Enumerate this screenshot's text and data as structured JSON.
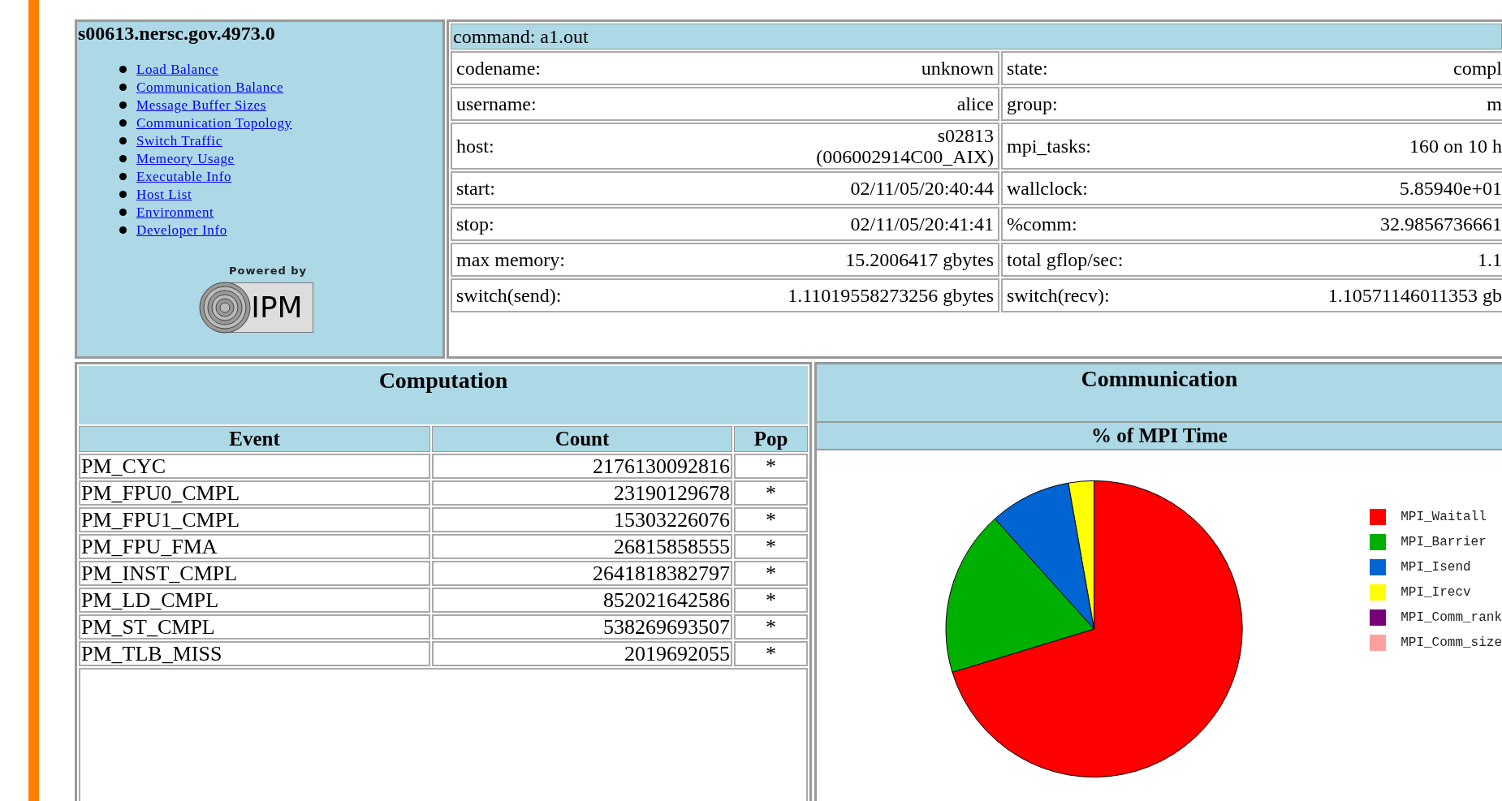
{
  "host_panel": {
    "title": "s00613.nersc.gov.4973.0",
    "links": [
      "Load Balance",
      "Communication Balance",
      "Message Buffer Sizes",
      "Communication Topology",
      "Switch Traffic",
      "Memeory Usage",
      "Executable Info",
      "Host List",
      "Environment",
      "Developer Info"
    ],
    "logo": {
      "caption": "Powered by",
      "name": "IPM"
    }
  },
  "summary": {
    "command": "command: a1.out",
    "rows": [
      {
        "label": "codename:",
        "value": [
          "unknown"
        ],
        "label_2": "state:",
        "value_2": "compl"
      },
      {
        "label": "username:",
        "value": [
          "alice"
        ],
        "label_2": "group:",
        "value_2": "m"
      },
      {
        "label": "host:",
        "value": [
          "s02813",
          "(006002914C00_AIX)"
        ],
        "label_2": "mpi_tasks:",
        "value_2": "160 on 10 h"
      },
      {
        "label": "start:",
        "value": [
          "02/11/05/20:40:44"
        ],
        "label_2": "wallclock:",
        "value_2": "5.85940e+01"
      },
      {
        "label": "stop:",
        "value": [
          "02/11/05/20:41:41"
        ],
        "label_2": "%comm:",
        "value_2": "32.9856736661"
      },
      {
        "label": "max memory:",
        "value": [
          "15.2006417 gbytes"
        ],
        "label_2": "total gflop/sec:",
        "value_2": "1.1"
      },
      {
        "label": "switch(send):",
        "value": [
          "1.11019558273256 gbytes"
        ],
        "label_2": "switch(recv):",
        "value_2": "1.10571146011353 gb"
      }
    ]
  },
  "computation": {
    "title": "Computation",
    "columns": [
      "Event",
      "Count",
      "Pop"
    ],
    "rows": [
      [
        "PM_CYC",
        "2176130092816",
        "*"
      ],
      [
        "PM_FPU0_CMPL",
        "23190129678",
        "*"
      ],
      [
        "PM_FPU1_CMPL",
        "15303226076",
        "*"
      ],
      [
        "PM_FPU_FMA",
        "26815858555",
        "*"
      ],
      [
        "PM_INST_CMPL",
        "2641818382797",
        "*"
      ],
      [
        "PM_LD_CMPL",
        "852021642586",
        "*"
      ],
      [
        "PM_ST_CMPL",
        "538269693507",
        "*"
      ],
      [
        "PM_TLB_MISS",
        "2019692055",
        "*"
      ]
    ]
  },
  "communication": {
    "title": "Communication",
    "subtitle": "% of MPI Time",
    "legend": [
      {
        "label": "MPI_Waitall",
        "color": "#ff0000"
      },
      {
        "label": "MPI_Barrier",
        "color": "#00b000"
      },
      {
        "label": "MPI_Isend",
        "color": "#0064d2"
      },
      {
        "label": "MPI_Irecv",
        "color": "#ffff00"
      },
      {
        "label": "MPI_Comm_rank",
        "color": "#780078"
      },
      {
        "label": "MPI_Comm_size",
        "color": "#ffa0a0"
      }
    ]
  }
}
